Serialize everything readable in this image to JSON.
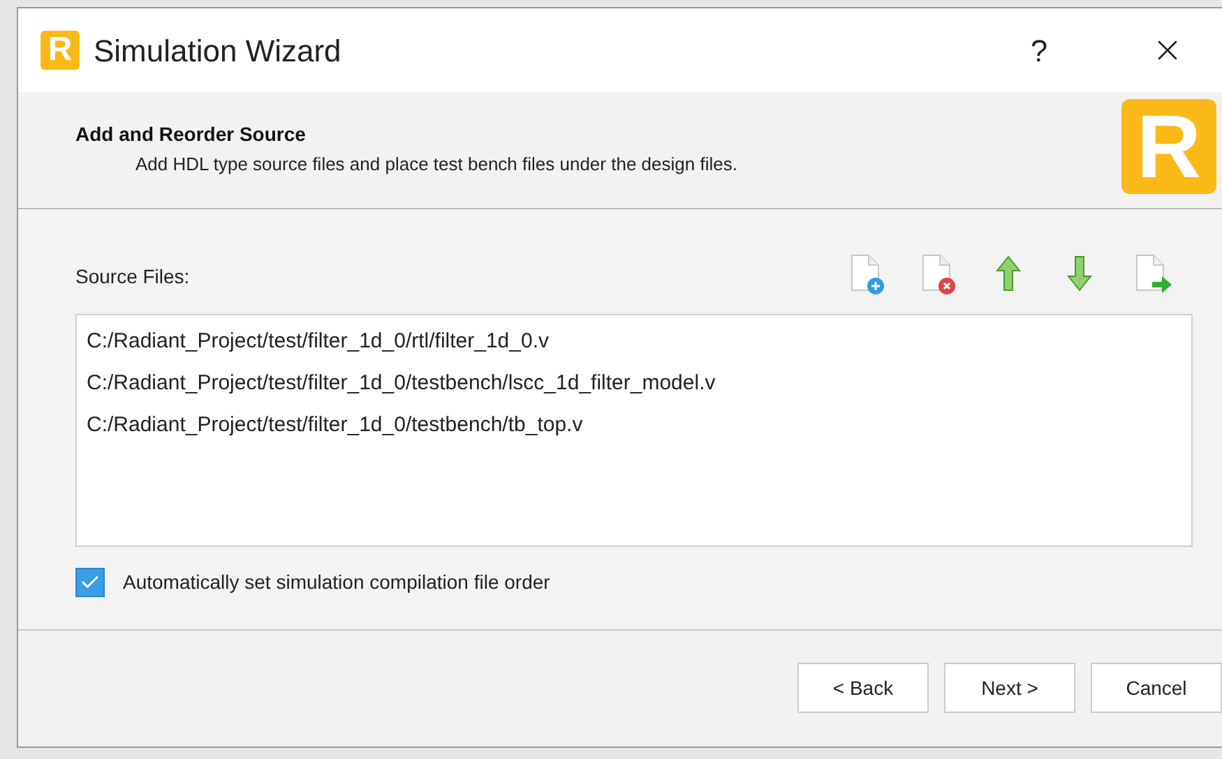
{
  "window": {
    "title": "Simulation Wizard",
    "app_logo_letter": "R",
    "help": "?"
  },
  "header": {
    "title": "Add and Reorder Source",
    "subtitle": "Add HDL type source files and place test bench files under the design files.",
    "logo_letter": "R"
  },
  "source_files": {
    "label": "Source Files:",
    "files": [
      "C:/Radiant_Project/test/filter_1d_0/rtl/filter_1d_0.v",
      "C:/Radiant_Project/test/filter_1d_0/testbench/lscc_1d_filter_model.v",
      "C:/Radiant_Project/test/filter_1d_0/testbench/tb_top.v"
    ]
  },
  "auto_order": {
    "label": "Automatically set simulation compilation file order",
    "checked": true
  },
  "buttons": [
    "< Back",
    "Next >",
    "Cancel"
  ]
}
